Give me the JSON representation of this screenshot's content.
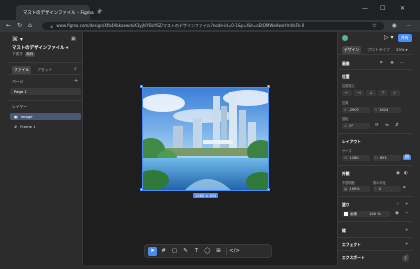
{
  "browser": {
    "tab_title": "マストのデザインファイル – Figma",
    "tab_close": "×",
    "new_tab": "+",
    "url": "www.figma.com/design/Xfb4AbkaewdvX3yjhlYBsY6Z/マストのデザインファイル?node-id=0-1&p=f&t=oEtDMWeHwoYmVkFk-0",
    "win_min": "—",
    "win_max": "☐",
    "win_close": "✕"
  },
  "left_panel": {
    "logo": "⌘ ▾",
    "panel_toggle": "▣",
    "file_name": "マストのデザインファイル ▾",
    "drafts": "下書き",
    "free_badge": "無料",
    "tabs": [
      "ファイル",
      "アセット"
    ],
    "pages_header": "ページ",
    "add": "+",
    "page_items": [
      "Page 1"
    ],
    "layers_header": "レイヤー",
    "layers": [
      {
        "icon": "▣",
        "label": "image",
        "selected": true
      },
      {
        "icon": "#",
        "label": "Frame 1",
        "selected": false
      }
    ]
  },
  "canvas": {
    "size_label": "1280 × 853"
  },
  "toolbar": {
    "tools": [
      {
        "icon": "➤",
        "active": true
      },
      {
        "icon": "#",
        "active": false
      },
      {
        "icon": "▢",
        "active": false
      },
      {
        "icon": "✎",
        "active": false
      },
      {
        "icon": "T",
        "active": false
      },
      {
        "icon": "◯",
        "active": false
      },
      {
        "icon": "⊞",
        "active": false
      },
      {
        "icon": "</>",
        "active": false
      }
    ]
  },
  "right_panel": {
    "play": "▷ ▾",
    "share_label": "共有",
    "tabs": [
      "デザイン",
      "プロトタイプ"
    ],
    "zoom": "33% ▾",
    "image_section": "画像",
    "position_header": "位置",
    "align_label": "位置揃え",
    "position_label": "位置",
    "x_key": "X",
    "x_value": "-2907",
    "y_key": "Y",
    "y_value": "3424",
    "rotation_label": "回転",
    "rotation_value": "0°",
    "layout_header": "レイアウト",
    "size_label": "サイズ",
    "w_key": "W",
    "w_value": "1280",
    "h_key": "H",
    "h_value": "853",
    "appearance_header": "外観",
    "opacity_label": "不透明度",
    "opacity_value": "100%",
    "radius_label": "角の半径",
    "radius_value": "0",
    "fill_header": "塗り",
    "fill_label": "画像",
    "fill_opacity": "100 %",
    "stroke_header": "線",
    "effects_header": "エフェクト",
    "export_header": "エクスポート"
  },
  "colors": {
    "accent": "#4a8bf5",
    "canvas_bg": "#1e1e1e",
    "panel_bg": "#2c2c2c"
  }
}
